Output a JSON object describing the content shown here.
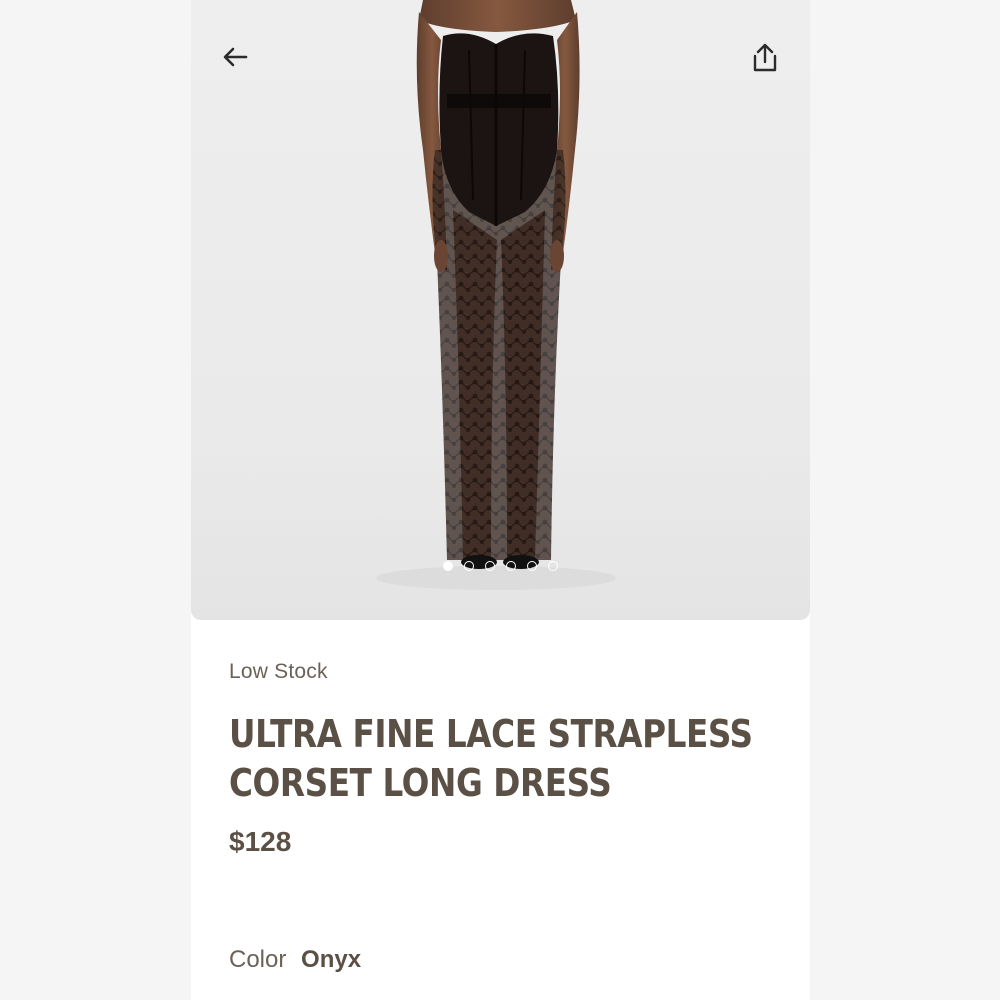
{
  "product": {
    "stock_status": "Low Stock",
    "title_line1": "ULTRA FINE LACE STRAPLESS",
    "title_line2": "CORSET LONG DRESS",
    "price": "$128",
    "color_label": "Color",
    "color_value": "Onyx"
  },
  "gallery": {
    "image_count": 6,
    "active_index": 0
  },
  "icons": {
    "back": "arrow-left-icon",
    "share": "share-icon"
  },
  "colors": {
    "text_primary": "#5a5045",
    "text_secondary": "#6b6257",
    "hero_bg": "#ececec",
    "dress": "#1a1412",
    "skin": "#7a5340"
  }
}
